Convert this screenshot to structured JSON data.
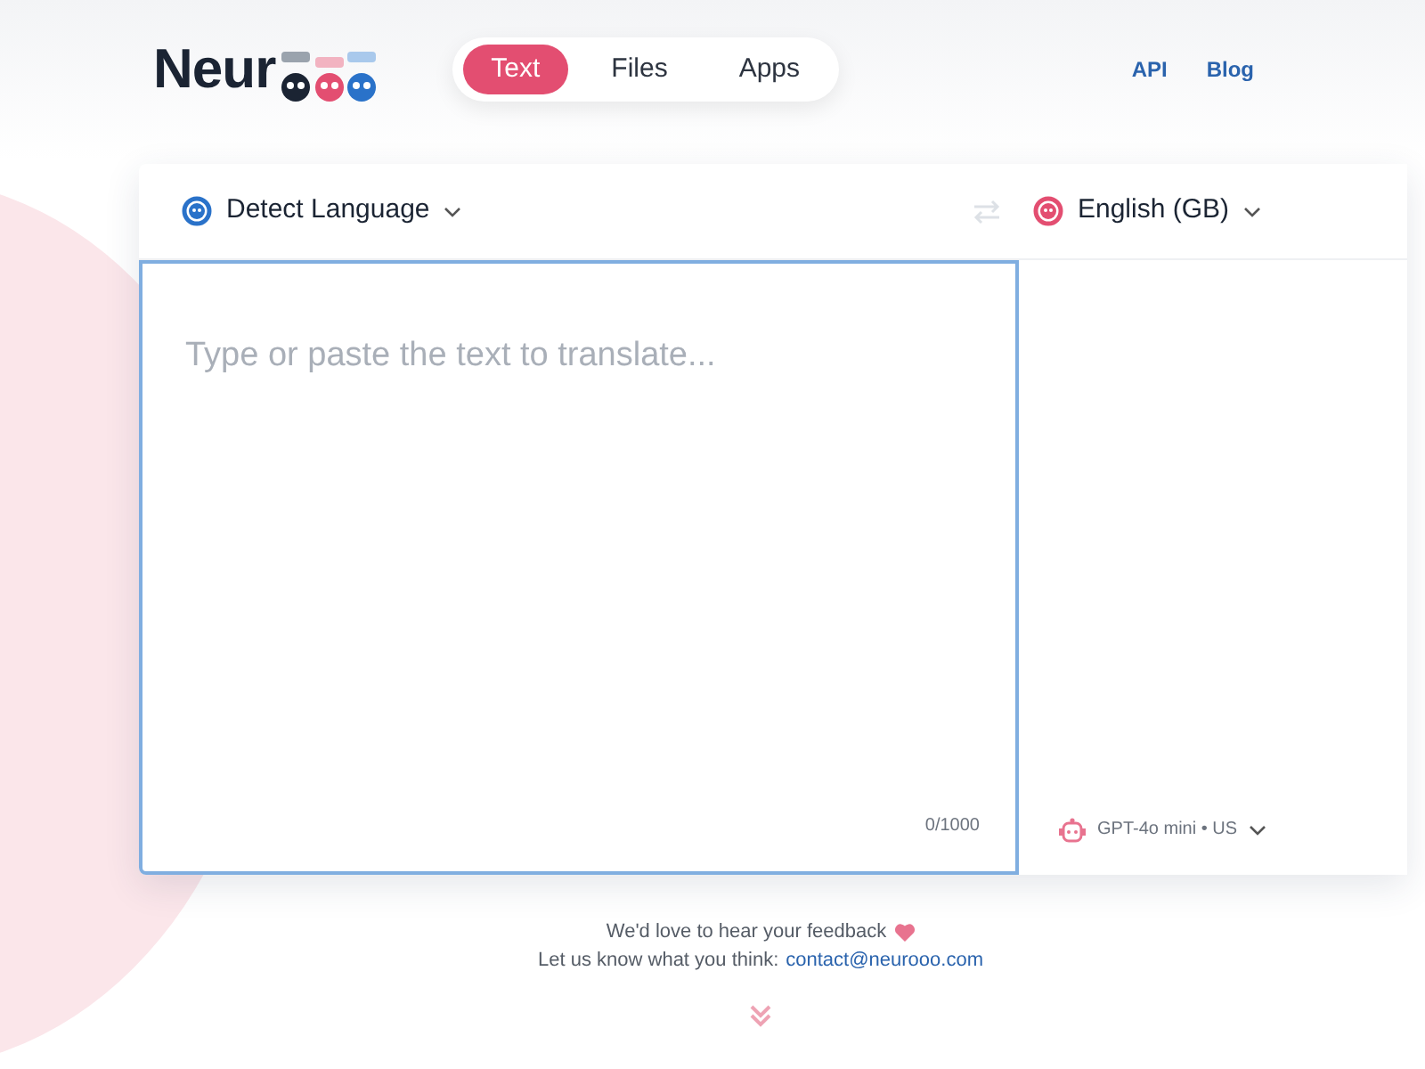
{
  "logo": {
    "text": "Neur"
  },
  "tabs": [
    {
      "label": "Text",
      "selected": true
    },
    {
      "label": "Files",
      "selected": false
    },
    {
      "label": "Apps",
      "selected": false
    }
  ],
  "links": [
    "API",
    "Blog"
  ],
  "source_language": {
    "label": "Detect Language"
  },
  "target_language": {
    "label": "English (GB)"
  },
  "input": {
    "placeholder": "Type or paste the text to translate...",
    "counter": "0/1000"
  },
  "model": {
    "label": "GPT-4o mini • US"
  },
  "feedback": {
    "line_1": "We'd love to hear your feedback",
    "line_2": "Let us know what you think:",
    "email": "contact@neurooo.com"
  }
}
